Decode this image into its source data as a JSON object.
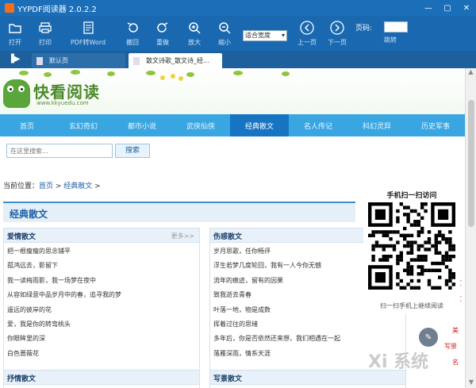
{
  "window": {
    "title": "YYPDF阅读器 2.0.2.2",
    "controls": [
      "—",
      "▢",
      "✕"
    ]
  },
  "toolbar": {
    "open": "打开",
    "print": "打印",
    "to_word": "PDF转Word",
    "undo": "撤回",
    "redo": "重做",
    "zoom_in": "放大",
    "zoom_out": "缩小",
    "zoom_value": "适合宽度",
    "prev_page": "上一页",
    "next_page": "下一页",
    "page_label": "页码:",
    "jump": "跳转"
  },
  "tabs": [
    {
      "label": "默认页",
      "active": false
    },
    {
      "label": "散文诗歌_散文诗_经...",
      "active": true
    }
  ],
  "site": {
    "logo_text": "快看阅读",
    "logo_sub": "www.kkyuedu.com",
    "nav": [
      "首页",
      "玄幻奇幻",
      "都市小说",
      "武侠仙侠",
      "经典散文",
      "名人传记",
      "科幻灵异",
      "历史军事"
    ],
    "nav_active_index": 4,
    "search_placeholder": "在这里搜索...",
    "search_button": "搜索",
    "breadcrumb_prefix": "当前位置：",
    "breadcrumb_home": "首页",
    "breadcrumb_current": "经典散文",
    "section_title": "经典散文",
    "col_left": {
      "title": "爱情散文",
      "more": "更多>>",
      "items": [
        "把一根瘦瘦的思念铺平",
        "孤鸿远去，影留下",
        "我一读梅雨影，我一场梦在夜中",
        "从容如绿意中品岁月中的春，追寻我的梦",
        "遥远的彼岸的花",
        "爱，我是你的转弯桃头",
        "你眼眸里的深",
        "白色蔷薇花"
      ]
    },
    "col_right": {
      "title": "伤感散文",
      "more": "",
      "items": [
        "岁月思歌，任你畅评",
        "浮生若梦几度轮回，我有一人今你无憾",
        "流年的痕迹，留有的因果",
        "致我逝去青春",
        "叶落一地，物是成数",
        "挥着过往的思绪",
        "多年后，你是否依然还来想，我们相遇在一起",
        "落雁深雨，情系天涯"
      ]
    },
    "col_left_next": "抒情散文",
    "col_right_next": "写景散文"
  },
  "qr": {
    "title": "手机扫一扫访问",
    "caption": "扫一扫手机上继续阅读"
  },
  "side_labels": [
    "文",
    "美",
    "美",
    "美文",
    "美文",
    "美",
    "写景",
    "名"
  ],
  "watermark": "Xi 系统",
  "colors": {
    "titlebar": "#1b6fb8",
    "nav": "#39a6e2",
    "nav_active": "#1674c3"
  }
}
